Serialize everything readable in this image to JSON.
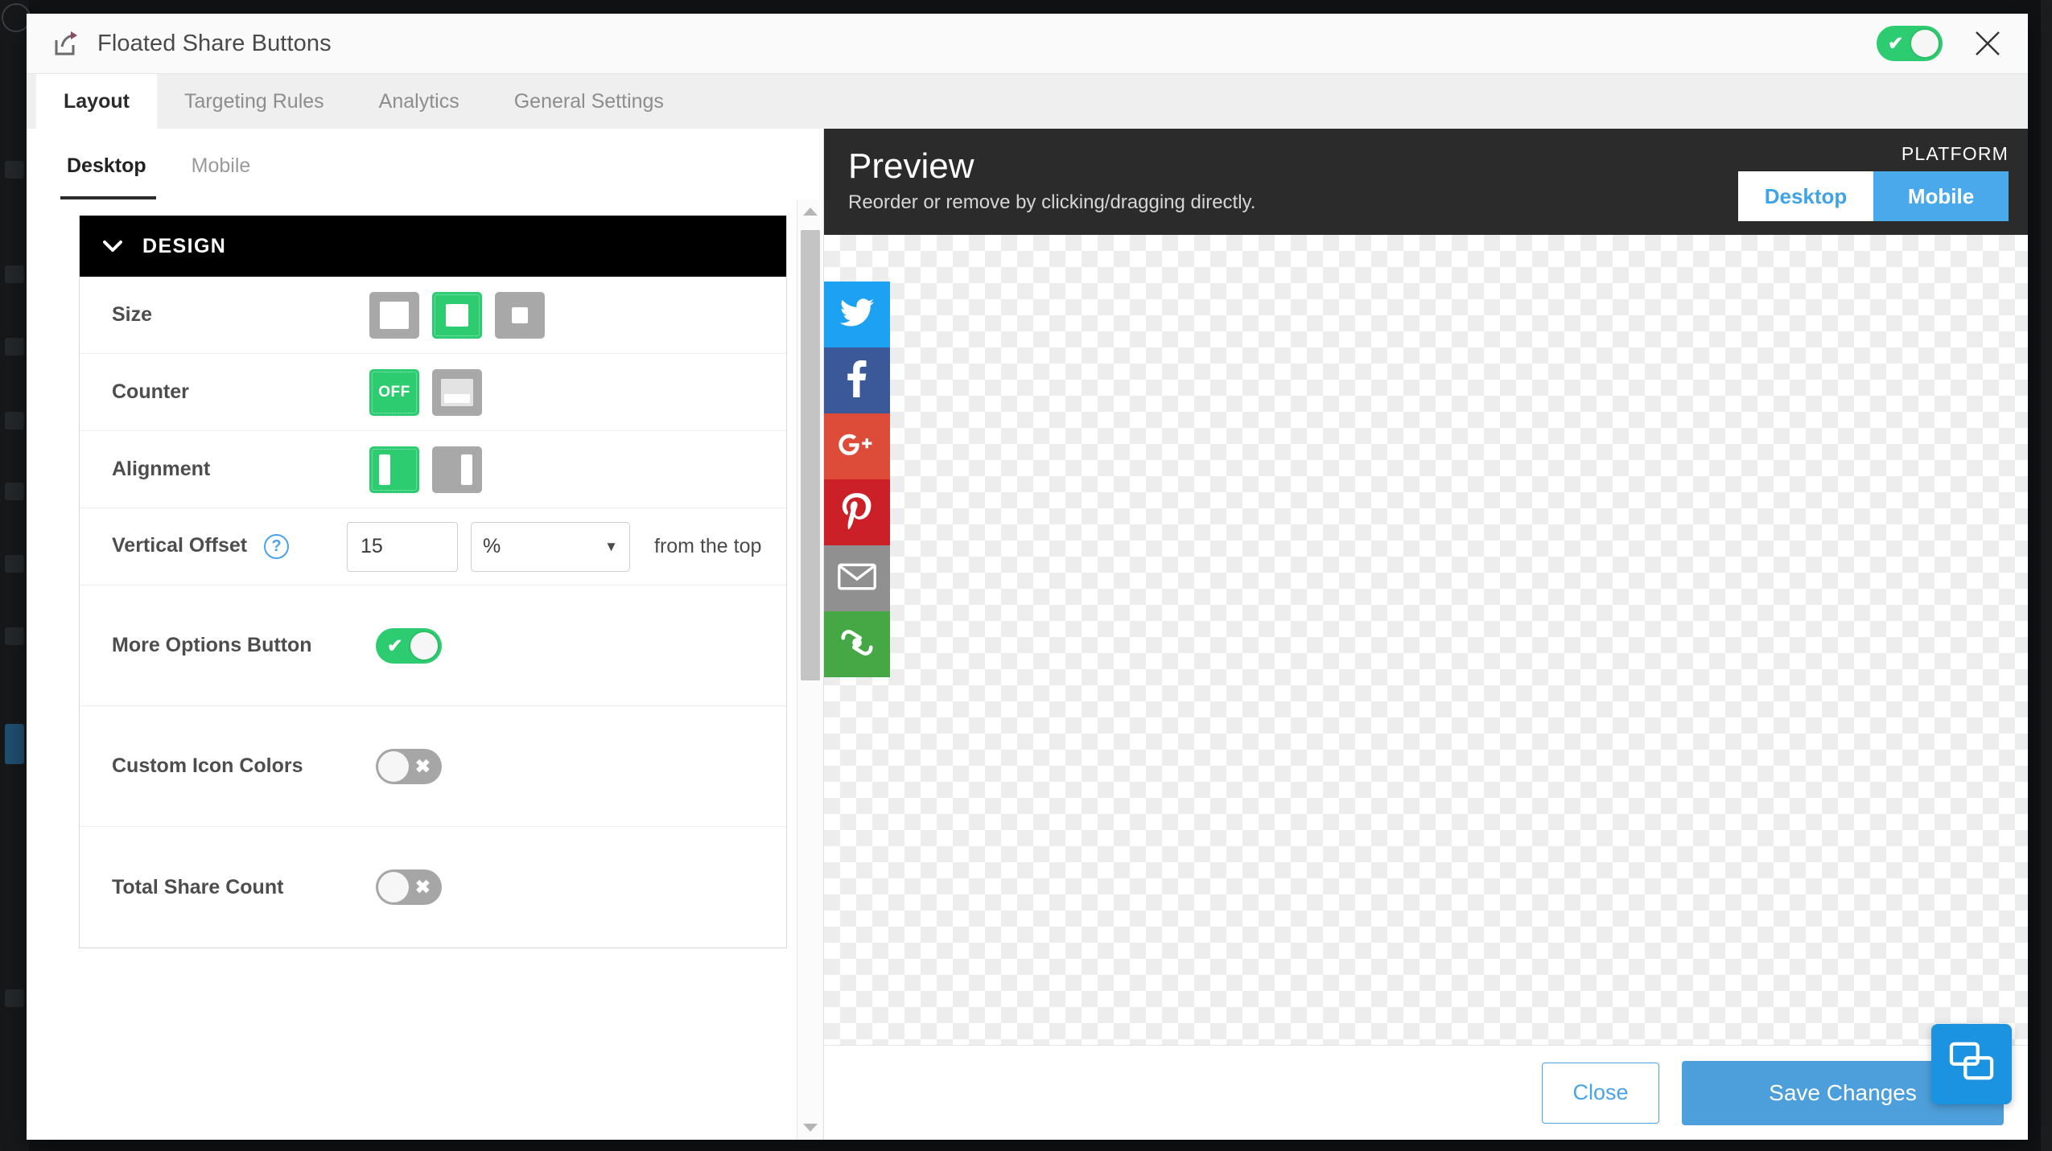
{
  "window": {
    "title": "Floated Share Buttons",
    "title_icon": "share-icon",
    "enabled_toggle_state": "on",
    "close_icon": "close-icon"
  },
  "tabs": [
    {
      "label": "Layout",
      "active": true
    },
    {
      "label": "Targeting Rules",
      "active": false
    },
    {
      "label": "Analytics",
      "active": false
    },
    {
      "label": "General Settings",
      "active": false
    }
  ],
  "subtabs": [
    {
      "label": "Desktop",
      "active": true
    },
    {
      "label": "Mobile",
      "active": false
    }
  ],
  "design_section": {
    "header": "DESIGN",
    "chevron_icon": "chevron-down-icon",
    "rows": {
      "size": {
        "label": "Size",
        "options": [
          {
            "name": "size-large",
            "selected": false
          },
          {
            "name": "size-medium",
            "selected": true
          },
          {
            "name": "size-small",
            "selected": false
          }
        ]
      },
      "counter": {
        "label": "Counter",
        "options": [
          {
            "name": "counter-off",
            "label": "OFF",
            "selected": true
          },
          {
            "name": "counter-on",
            "label": "",
            "selected": false
          }
        ]
      },
      "alignment": {
        "label": "Alignment",
        "options": [
          {
            "name": "align-left",
            "selected": true
          },
          {
            "name": "align-right",
            "selected": false
          }
        ]
      },
      "vertical_offset": {
        "label": "Vertical Offset",
        "help_icon": "question-mark-icon",
        "value": "15",
        "unit": "%",
        "unit_caret": "▼",
        "suffix": "from the top"
      },
      "more_options_button": {
        "label": "More Options Button",
        "state": "on",
        "mark": "✔"
      },
      "custom_icon_colors": {
        "label": "Custom Icon Colors",
        "state": "off",
        "mark": "✖"
      },
      "total_share_count": {
        "label": "Total Share Count",
        "state": "off",
        "mark": "✖"
      }
    }
  },
  "preview": {
    "title": "Preview",
    "subtitle": "Reorder or remove by clicking/dragging directly.",
    "platform_label": "PLATFORM",
    "platform_options": [
      {
        "label": "Desktop",
        "active": true
      },
      {
        "label": "Mobile",
        "active": false
      }
    ],
    "share_buttons": [
      {
        "name": "twitter-share-button",
        "icon": "twitter-icon",
        "color": "#1da1f2"
      },
      {
        "name": "facebook-share-button",
        "icon": "facebook-icon",
        "color": "#3b5998"
      },
      {
        "name": "googleplus-share-button",
        "icon": "google-plus-icon",
        "color": "#dd4b39"
      },
      {
        "name": "pinterest-share-button",
        "icon": "pinterest-icon",
        "color": "#cb2027"
      },
      {
        "name": "email-share-button",
        "icon": "envelope-icon",
        "color": "#909090"
      },
      {
        "name": "addthis-share-button",
        "icon": "addthis-icon",
        "color": "#45a845"
      }
    ]
  },
  "footer": {
    "close_label": "Close",
    "save_label": "Save Changes",
    "chat_icon": "chat-bubbles-icon"
  },
  "colors": {
    "accent_green": "#2ecc71",
    "accent_blue": "#4aa3e8",
    "save_blue": "#4d9fdb",
    "header_black": "#000000"
  }
}
